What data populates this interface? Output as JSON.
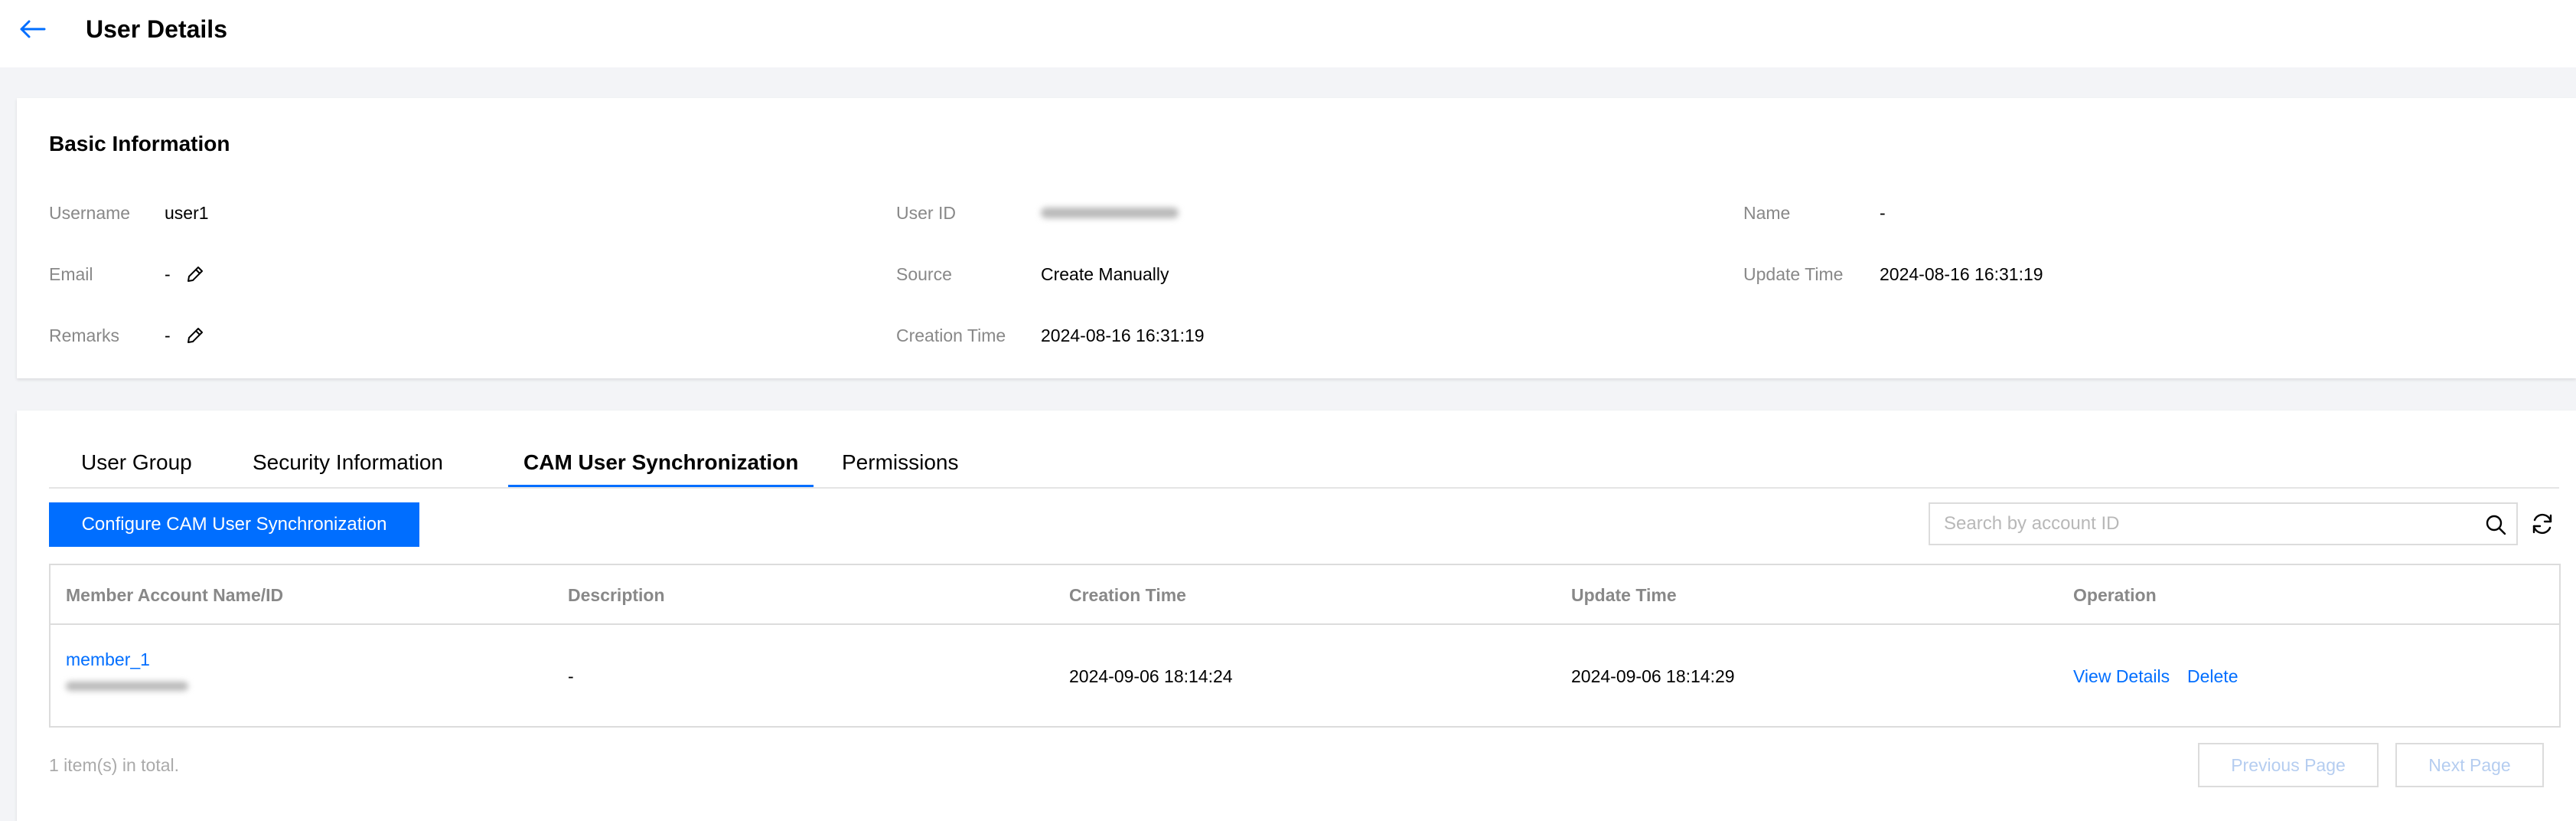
{
  "header": {
    "title": "User Details"
  },
  "basic_info": {
    "title": "Basic Information",
    "fields": [
      {
        "label": "Username",
        "value": "user1"
      },
      {
        "label": "User ID",
        "value": ""
      },
      {
        "label": "Name",
        "value": "-"
      },
      {
        "label": "Email",
        "value": "-"
      },
      {
        "label": "Source",
        "value": "Create Manually"
      },
      {
        "label": "Update Time",
        "value": "2024-08-16 16:31:19"
      },
      {
        "label": "Remarks",
        "value": "-"
      },
      {
        "label": "Creation Time",
        "value": "2024-08-16 16:31:19"
      }
    ]
  },
  "tabs": [
    {
      "label": "User Group"
    },
    {
      "label": "Security Information"
    },
    {
      "label": "CAM User Synchronization",
      "active": true
    },
    {
      "label": "Permissions"
    }
  ],
  "toolbar": {
    "configure_label": "Configure CAM User Synchronization",
    "search_placeholder": "Search by account ID"
  },
  "table": {
    "columns": [
      "Member Account Name/ID",
      "Description",
      "Creation Time",
      "Update Time",
      "Operation"
    ],
    "rows": [
      {
        "name": "member_1",
        "description": "-",
        "creation_time": "2024-09-06 18:14:24",
        "update_time": "2024-09-06 18:14:29",
        "actions": [
          "View Details",
          "Delete"
        ]
      }
    ]
  },
  "footer": {
    "total": "1 item(s) in total.",
    "prev_label": "Previous Page",
    "next_label": "Next Page"
  },
  "colors": {
    "accent": "#006eff",
    "page_bg": "#f3f4f7",
    "label": "#888888"
  },
  "icons": [
    "back-arrow-icon",
    "pencil-icon",
    "search-icon",
    "refresh-icon"
  ]
}
